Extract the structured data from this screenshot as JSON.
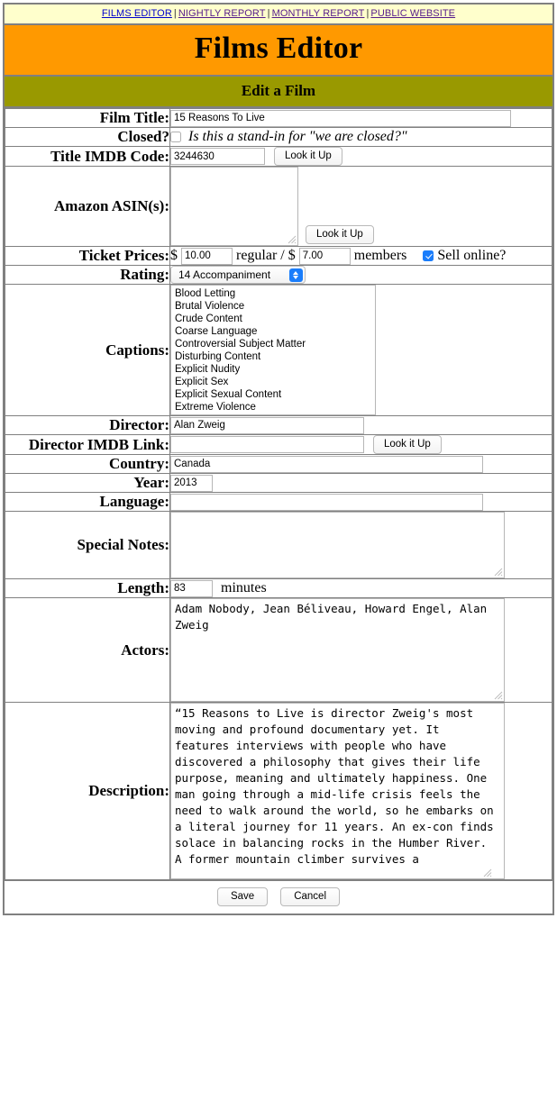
{
  "nav": {
    "items": [
      {
        "label": "FILMS EDITOR",
        "current": true
      },
      {
        "label": "NIGHTLY REPORT",
        "current": false
      },
      {
        "label": "MONTHLY REPORT",
        "current": false
      },
      {
        "label": "PUBLIC WEBSITE",
        "current": false
      }
    ],
    "separator": "|"
  },
  "header": {
    "title": "Films Editor",
    "subtitle": "Edit a Film"
  },
  "colors": {
    "nav_bg": "#FFFFCC",
    "title_bg": "#FF9900",
    "subtitle_bg": "#999900",
    "border": "#808080",
    "accent_blue": "#1A7DFB",
    "link": "#551A8B"
  },
  "form": {
    "film_title": {
      "label": "Film Title:",
      "value": "15 Reasons To Live",
      "placeholder": ""
    },
    "closed": {
      "label": "Closed?",
      "checked": false,
      "note": "Is this a stand-in for \"we are closed?\""
    },
    "title_imdb_code": {
      "label": "Title IMDB Code:",
      "value": "3244630",
      "button": "Look it Up"
    },
    "amazon_asin": {
      "label": "Amazon ASIN(s):",
      "value": "",
      "button": "Look it Up"
    },
    "ticket_prices": {
      "label": "Ticket Prices:",
      "currency": "$",
      "regular_value": "10.00",
      "regular_text": "regular / ",
      "members_value": "7.00",
      "members_text": "members",
      "sell_online_label": "Sell online?",
      "sell_online_checked": true
    },
    "rating": {
      "label": "Rating:",
      "selected": "14 Accompaniment"
    },
    "captions": {
      "label": "Captions:",
      "options": [
        "Blood Letting",
        "Brutal Violence",
        "Crude Content",
        "Coarse Language",
        "Controversial Subject Matter",
        "Disturbing Content",
        "Explicit Nudity",
        "Explicit Sex",
        "Explicit Sexual Content",
        "Extreme Violence"
      ]
    },
    "director": {
      "label": "Director:",
      "value": "Alan Zweig"
    },
    "director_imdb_link": {
      "label": "Director IMDB Link:",
      "value": "",
      "button": "Look it Up"
    },
    "country": {
      "label": "Country:",
      "value": "Canada"
    },
    "year": {
      "label": "Year:",
      "value": "2013"
    },
    "language": {
      "label": "Language:",
      "value": ""
    },
    "special_notes": {
      "label": "Special Notes:",
      "value": ""
    },
    "length": {
      "label": "Length:",
      "value": "83",
      "unit": "minutes"
    },
    "actors": {
      "label": "Actors:",
      "value": "Adam Nobody, Jean Béliveau, Howard Engel, Alan Zweig"
    },
    "description": {
      "label": "Description:",
      "value": "“15 Reasons to Live is director Zweig's most moving and profound documentary yet. It features interviews with people who have discovered a philosophy that gives their life purpose, meaning and ultimately happiness. One man going through a mid-life crisis feels the need to walk around the world, so he embarks on a literal journey for 11 years. An ex-con finds solace in balancing rocks in the Humber River. A former mountain climber survives a"
    }
  },
  "footer": {
    "save_label": "Save",
    "cancel_label": "Cancel"
  }
}
